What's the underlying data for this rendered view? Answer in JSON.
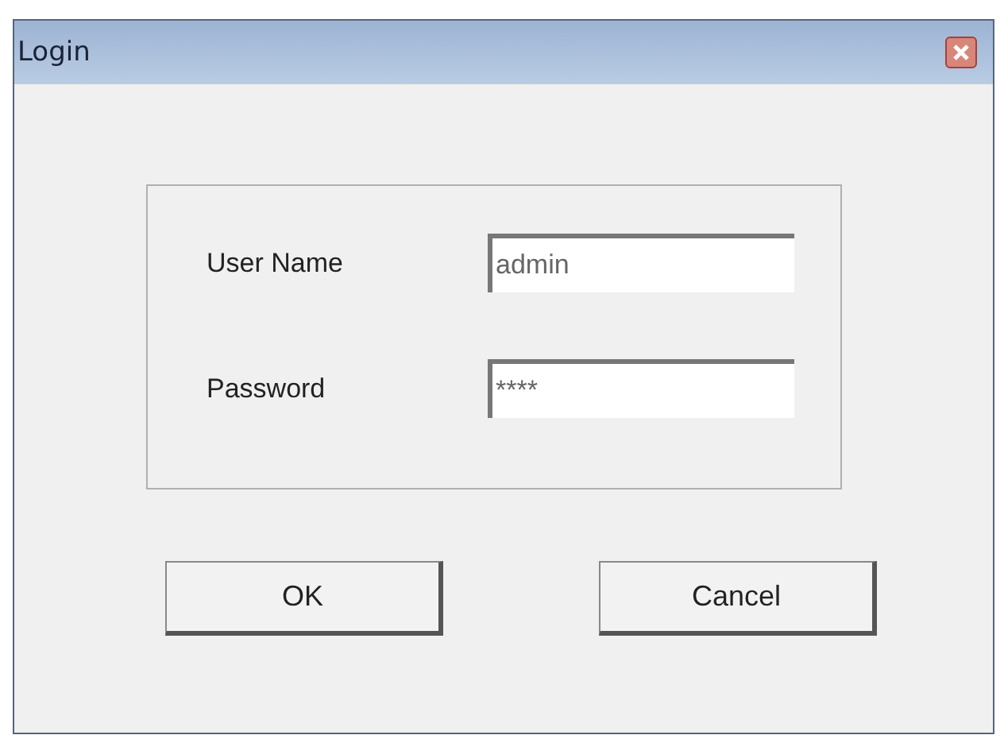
{
  "window": {
    "title": "Login"
  },
  "fields": [
    {
      "label": "User Name",
      "value": "admin"
    },
    {
      "label": "Password",
      "value": "****"
    }
  ],
  "buttons": [
    "OK",
    "Cancel"
  ]
}
